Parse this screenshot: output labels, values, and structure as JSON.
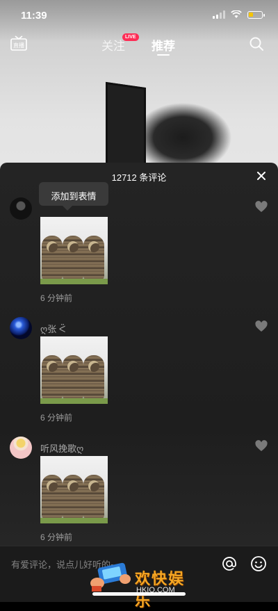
{
  "status_bar": {
    "time": "11:39"
  },
  "top_nav": {
    "live_label": "直播",
    "tabs": [
      {
        "label": "关注"
      },
      {
        "label": "推荐"
      }
    ],
    "live_badge": "LIVE"
  },
  "comments_panel": {
    "count_title": "12712 条评论",
    "tooltip": "添加到表情",
    "comments": [
      {
        "username": "",
        "timestamp": "6 分钟前"
      },
      {
        "username": "ღ张 ᑈ",
        "timestamp": "6 分钟前"
      },
      {
        "username": "听风挽歌ღ",
        "timestamp": "6 分钟前"
      }
    ]
  },
  "input_bar": {
    "placeholder": "有爱评论，说点儿好听的~"
  },
  "watermark": {
    "title": "欢快娱乐",
    "subtitle": "HKIO.COM"
  },
  "colors": {
    "accent": "#fe2c55",
    "panel": "#1e1e1e",
    "watermark": "#f5a623"
  }
}
